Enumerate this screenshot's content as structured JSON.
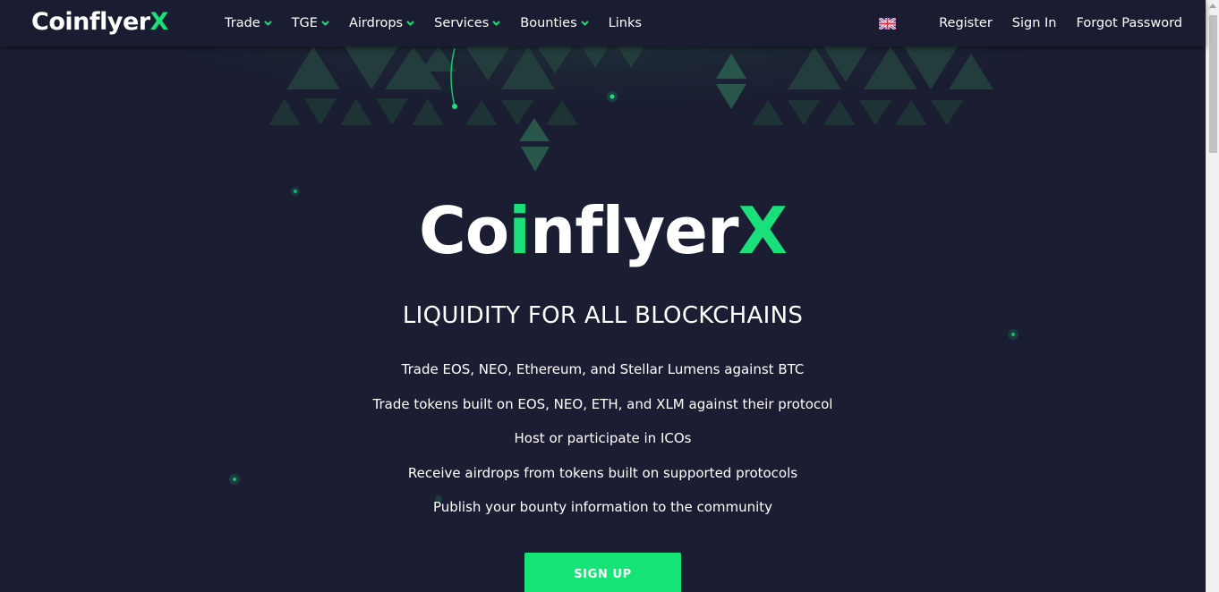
{
  "brand": {
    "logo_text_a": "Co",
    "logo_text_i": "i",
    "logo_text_b": "nfl",
    "logo_text_c": "yer",
    "logo_text_x": "X"
  },
  "nav": {
    "menu": [
      {
        "label": "Trade",
        "dropdown": true
      },
      {
        "label": "TGE",
        "dropdown": true
      },
      {
        "label": "Airdrops",
        "dropdown": true
      },
      {
        "label": "Services",
        "dropdown": true
      },
      {
        "label": "Bounties",
        "dropdown": true
      },
      {
        "label": "Links",
        "dropdown": false
      }
    ],
    "language_icon": "uk-flag-icon",
    "register": "Register",
    "sign_in": "Sign In",
    "forgot_password": "Forgot Password"
  },
  "hero": {
    "title": "LIQUIDITY FOR ALL BLOCKCHAINS",
    "features": [
      "Trade EOS, NEO, Ethereum, and Stellar Lumens against BTC",
      "Trade tokens built on EOS, NEO, ETH, and XLM against their protocol",
      "Host or participate in ICOs",
      "Receive airdrops from tokens built on supported protocols",
      "Publish your bounty information to the community"
    ],
    "signup_label": "SIGN UP"
  },
  "colors": {
    "background": "#1b1e33",
    "navbar": "#1a1d31",
    "accent": "#19e07a",
    "button": "#16e477"
  }
}
